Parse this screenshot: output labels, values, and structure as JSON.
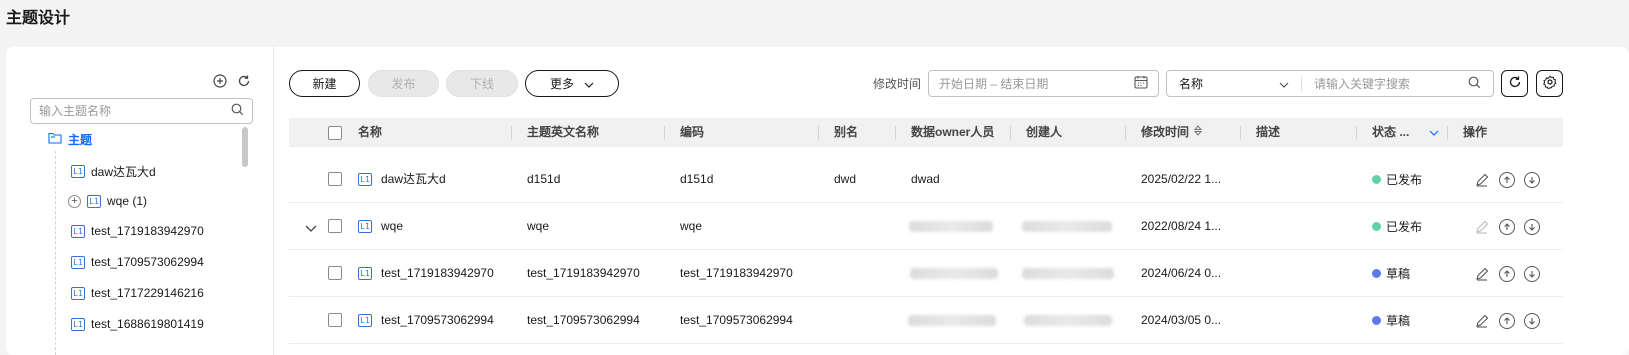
{
  "page": {
    "title": "主题设计"
  },
  "tree": {
    "search_placeholder": "输入主题名称",
    "root_label": "主题",
    "nodes": [
      {
        "label": "daw达瓦大d",
        "badge": "L1",
        "expandable": false
      },
      {
        "label": "wqe (1)",
        "badge": "L1",
        "expandable": true
      },
      {
        "label": "test_1719183942970",
        "badge": "L1",
        "expandable": false
      },
      {
        "label": "test_1709573062994",
        "badge": "L1",
        "expandable": false
      },
      {
        "label": "test_1717229146216",
        "badge": "L1",
        "expandable": false
      },
      {
        "label": "test_1688619801419",
        "badge": "L1",
        "expandable": false
      }
    ]
  },
  "toolbar": {
    "new_label": "新建",
    "publish_label": "发布",
    "offline_label": "下线",
    "more_label": "更多",
    "modified_time_label": "修改时间",
    "date_placeholder": "开始日期 – 结束日期",
    "filter_field": "名称",
    "keyword_placeholder": "请输入关键字搜索"
  },
  "table": {
    "headers": {
      "name": "名称",
      "en_name": "主题英文名称",
      "code": "编码",
      "alias": "别名",
      "owner": "数据owner人员",
      "creator": "创建人",
      "modified": "修改时间",
      "desc": "描述",
      "status": "状态 ...",
      "ops": "操作"
    },
    "rows": [
      {
        "badge": "L1",
        "name": "daw达瓦大d",
        "en_name": "d151d",
        "code": "d151d",
        "alias": "dwd",
        "owner": "dwad",
        "creator": "",
        "modified": "2025/02/22 1...",
        "status": "已发布",
        "expandable": false
      },
      {
        "badge": "L1",
        "name": "wqe",
        "en_name": "wqe",
        "code": "wqe",
        "alias": "",
        "owner": "",
        "creator": "",
        "modified": "2022/08/24 1...",
        "status": "已发布",
        "expandable": true
      },
      {
        "badge": "L1",
        "name": "test_1719183942970",
        "en_name": "test_1719183942970",
        "code": "test_1719183942970",
        "alias": "",
        "owner": "",
        "creator": "",
        "modified": "2024/06/24 0...",
        "status": "草稿",
        "expandable": false
      },
      {
        "badge": "L1",
        "name": "test_1709573062994",
        "en_name": "test_1709573062994",
        "code": "test_1709573062994",
        "alias": "",
        "owner": "",
        "creator": "",
        "modified": "2024/03/05 0...",
        "status": "草稿",
        "expandable": false
      }
    ]
  },
  "colors": {
    "published": "#5fd3a6",
    "draft": "#5b7be8",
    "accent": "#0a6cff"
  }
}
